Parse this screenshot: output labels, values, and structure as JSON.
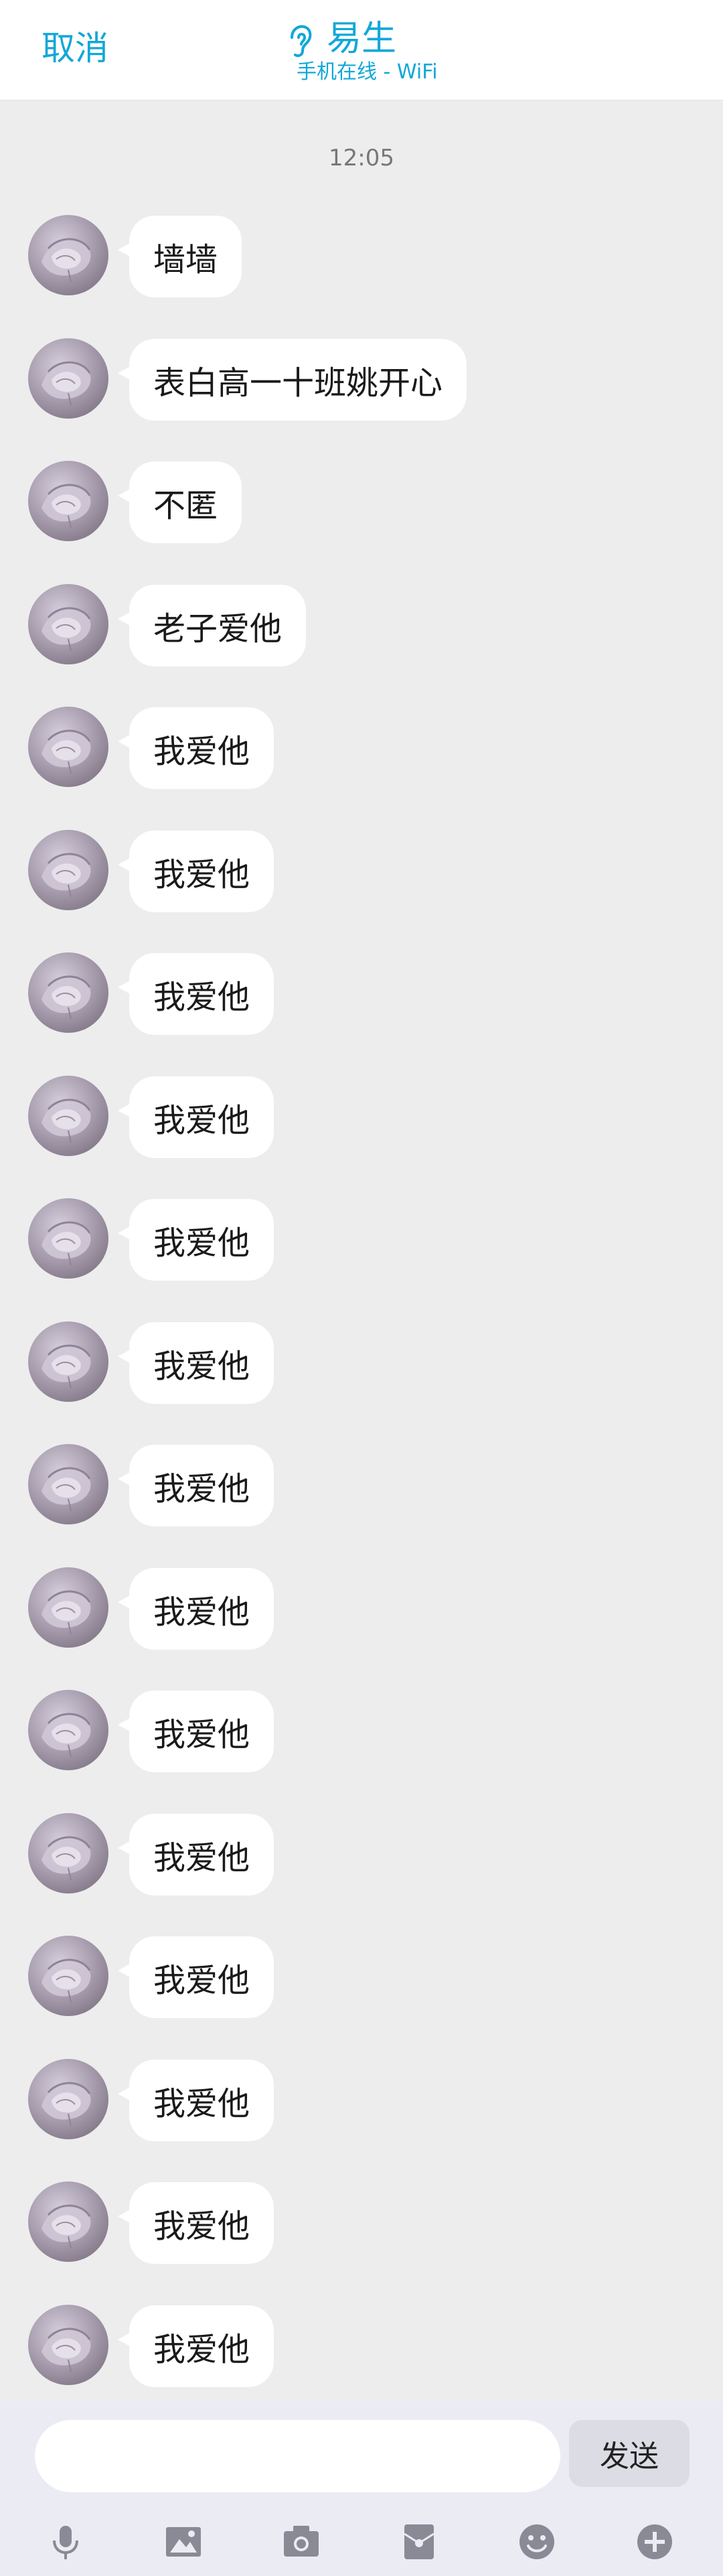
{
  "header": {
    "cancel_label": "取消",
    "title": "易生",
    "subtitle": "手机在线 - WiFi",
    "ear_icon": "ear-icon",
    "accent_color": "#12a7d8"
  },
  "chat": {
    "timestamp": "12:05",
    "messages": [
      {
        "text": "墙墙"
      },
      {
        "text": "表白高一十班姚开心"
      },
      {
        "text": "不匿"
      },
      {
        "text": "老子爱他"
      },
      {
        "text": "我爱他"
      },
      {
        "text": "我爱他"
      },
      {
        "text": "我爱他"
      },
      {
        "text": "我爱他"
      },
      {
        "text": "我爱他"
      },
      {
        "text": "我爱他"
      },
      {
        "text": "我爱他"
      },
      {
        "text": "我爱他"
      },
      {
        "text": "我爱他"
      },
      {
        "text": "我爱他"
      },
      {
        "text": "我爱他"
      },
      {
        "text": "我爱他"
      },
      {
        "text": "我爱他"
      },
      {
        "text": "我爱他"
      }
    ]
  },
  "input": {
    "value": "",
    "send_label": "发送"
  },
  "toolbar": {
    "icons": [
      "microphone-icon",
      "image-icon",
      "camera-icon",
      "red-packet-icon",
      "emoji-icon",
      "plus-icon"
    ]
  }
}
